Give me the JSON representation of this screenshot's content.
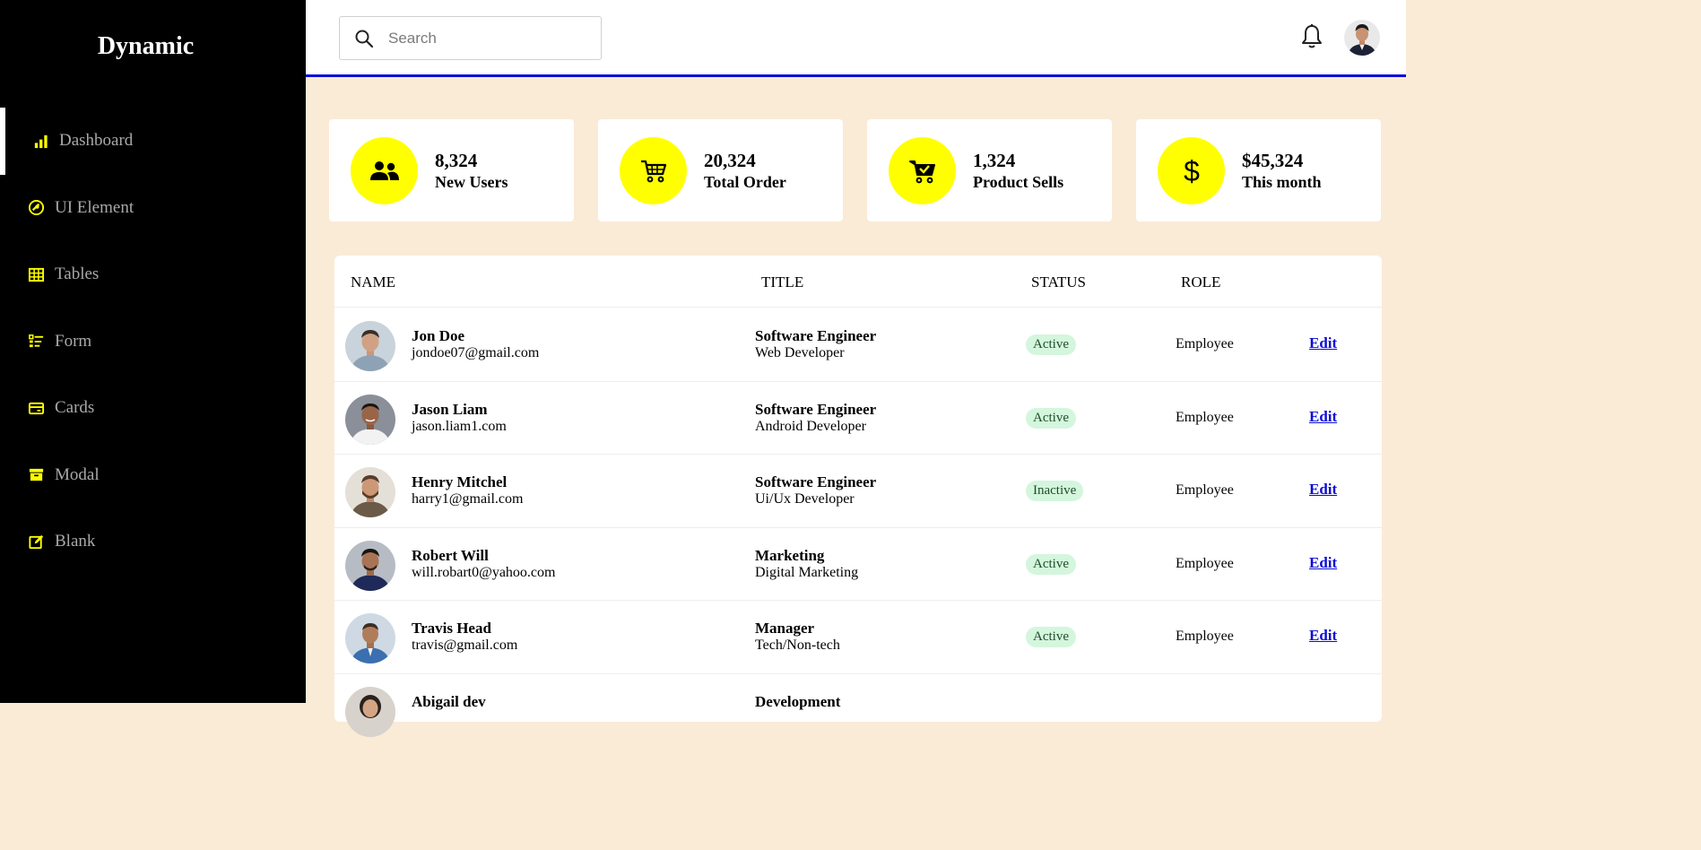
{
  "brand": "Dynamic",
  "sidebar": {
    "items": [
      {
        "label": "Dashboard",
        "icon": "bar-chart-icon"
      },
      {
        "label": "UI Element",
        "icon": "palette-icon"
      },
      {
        "label": "Tables",
        "icon": "table-icon"
      },
      {
        "label": "Form",
        "icon": "form-list-icon"
      },
      {
        "label": "Cards",
        "icon": "credit-card-icon"
      },
      {
        "label": "Modal",
        "icon": "archive-box-icon"
      },
      {
        "label": "Blank",
        "icon": "edit-square-icon"
      }
    ],
    "active_index": 0
  },
  "search": {
    "placeholder": "Search",
    "value": ""
  },
  "stats": [
    {
      "value": "8,324",
      "label": "New Users",
      "icon": "users-icon"
    },
    {
      "value": "20,324",
      "label": "Total Order",
      "icon": "cart-icon"
    },
    {
      "value": "1,324",
      "label": "Product Sells",
      "icon": "cart-check-icon"
    },
    {
      "value": "$45,324",
      "label": "This month",
      "icon": "dollar-icon"
    }
  ],
  "table": {
    "headers": {
      "name": "NAME",
      "title": "TITLE",
      "status": "STATUS",
      "role": "ROLE"
    },
    "rows": [
      {
        "name": "Jon Doe",
        "email": "jondoe07@gmail.com",
        "title": "Software Engineer",
        "subtitle": "Web Developer",
        "status": "Active",
        "role": "Employee",
        "action": "Edit"
      },
      {
        "name": "Jason Liam",
        "email": "jason.liam1.com",
        "title": "Software Engineer",
        "subtitle": "Android Developer",
        "status": "Active",
        "role": "Employee",
        "action": "Edit"
      },
      {
        "name": "Henry Mitchel",
        "email": "harry1@gmail.com",
        "title": "Software Engineer",
        "subtitle": "Ui/Ux Developer",
        "status": "Inactive",
        "role": "Employee",
        "action": "Edit"
      },
      {
        "name": "Robert Will",
        "email": "will.robart0@yahoo.com",
        "title": "Marketing",
        "subtitle": "Digital Marketing",
        "status": "Active",
        "role": "Employee",
        "action": "Edit"
      },
      {
        "name": "Travis Head",
        "email": "travis@gmail.com",
        "title": "Manager",
        "subtitle": "Tech/Non-tech",
        "status": "Active",
        "role": "Employee",
        "action": "Edit"
      },
      {
        "name": "Abigail dev",
        "email": "",
        "title": "Development",
        "subtitle": "",
        "status": "",
        "role": "",
        "action": ""
      }
    ]
  },
  "colors": {
    "accent": "#ffff00",
    "sidebar_bg": "#000000",
    "content_bg": "#faebd7",
    "topbar_border": "#0b0bd6",
    "status_bg": "#d4f6dd"
  }
}
